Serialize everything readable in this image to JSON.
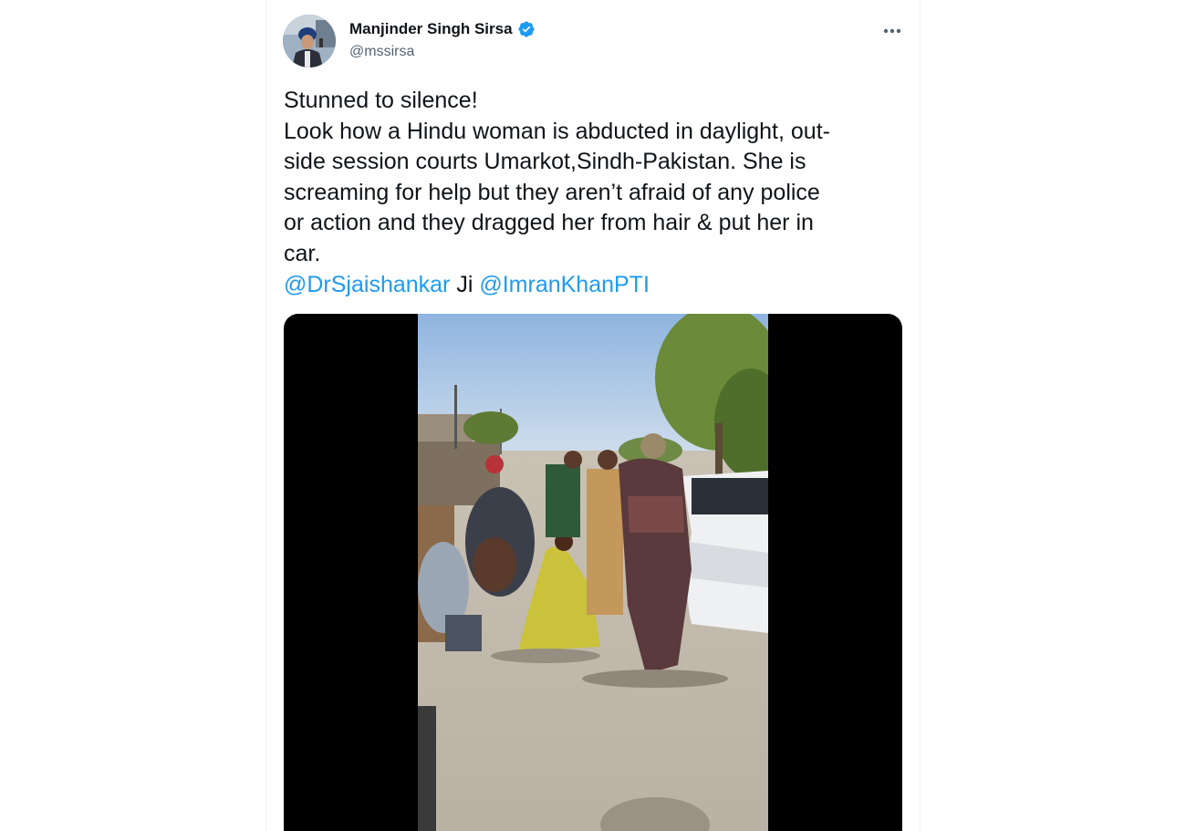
{
  "tweet": {
    "author": {
      "name": "Manjinder Singh Sirsa",
      "handle": "@mssirsa",
      "verified": true
    },
    "text_lines": [
      "Stunned to silence!",
      "Look how a Hindu woman is abducted in daylight, out-",
      "side session courts Umarkot,Sindh-Pakistan. She is",
      "screaming for help but they aren’t afraid of any police",
      "or action and they dragged her from hair & put her in",
      "car."
    ],
    "mentions": {
      "first": "@DrSjaishankar",
      "joiner": " Ji ",
      "second": "@ImranKhanPTI"
    },
    "media": {
      "type": "video"
    }
  },
  "colors": {
    "link": "#1d9bf0",
    "verified": "#1d9bf0",
    "text": "#0f1419",
    "secondary": "#536471"
  },
  "icons": {
    "verified": "verified-badge-icon",
    "more": "more-options-icon"
  }
}
